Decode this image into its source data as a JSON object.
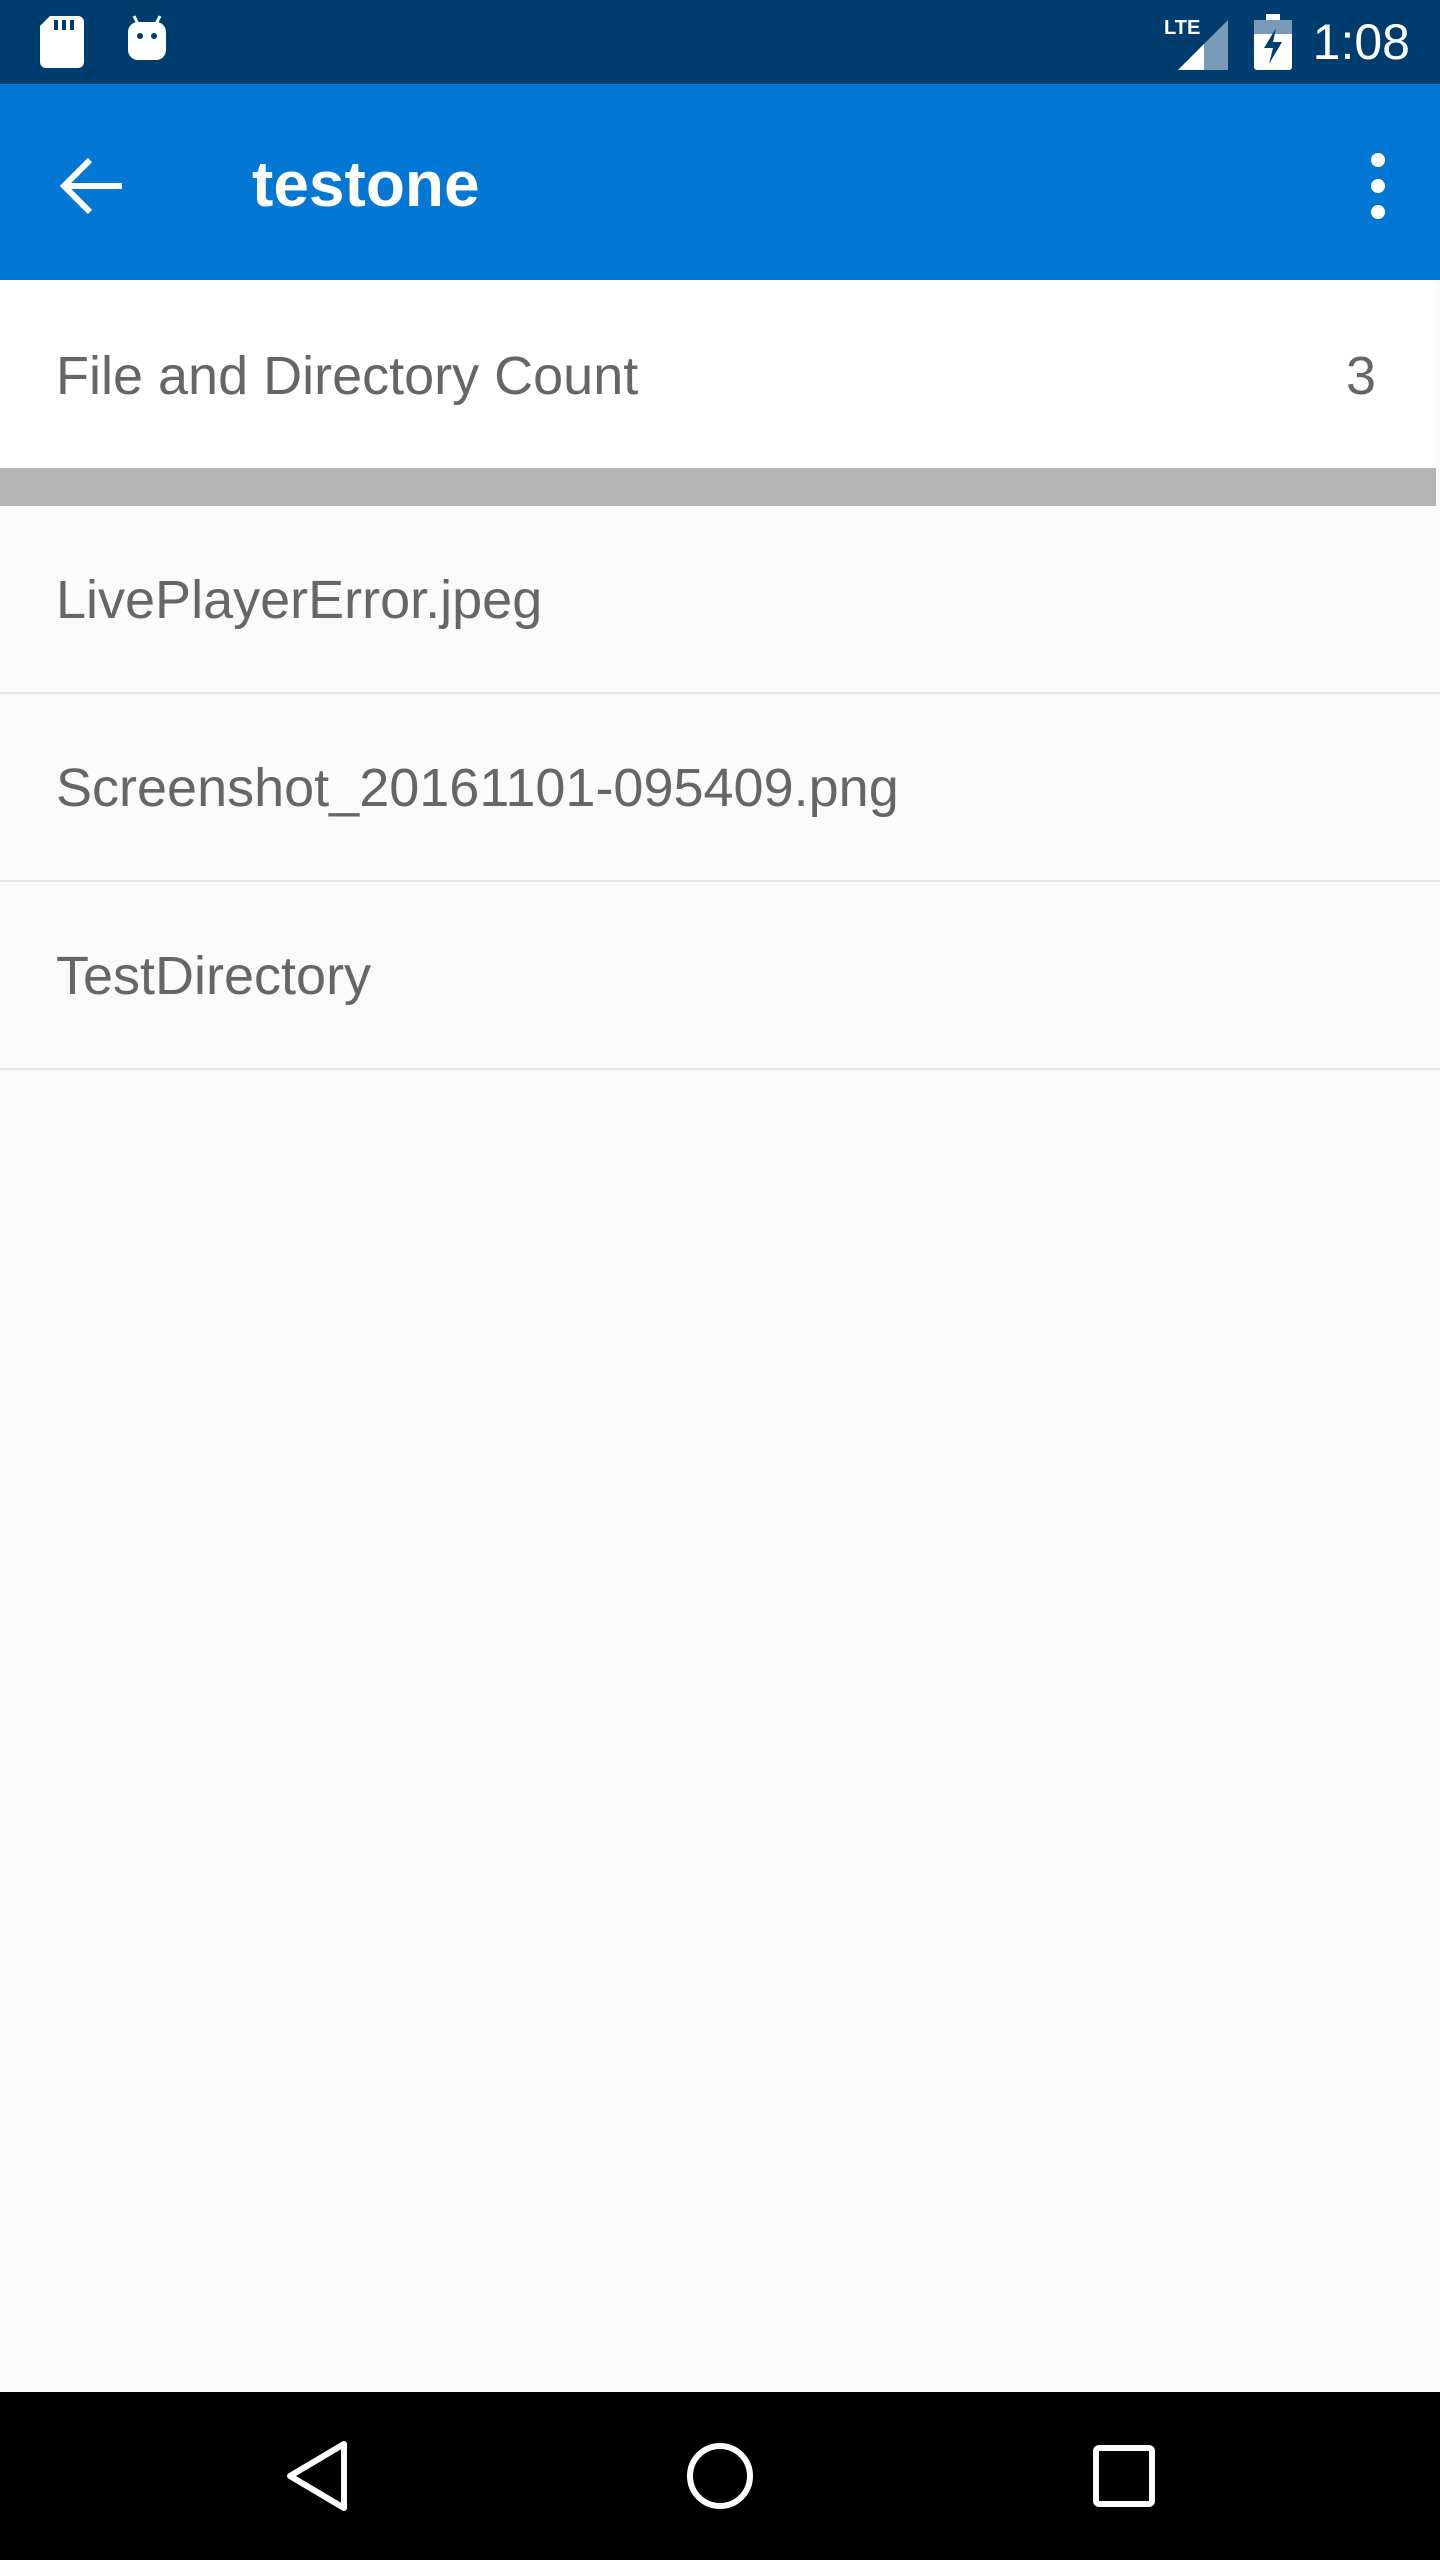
{
  "status_bar": {
    "time": "1:08",
    "network": "LTE",
    "icons": [
      "sd-card-icon",
      "android-icon",
      "lte-signal-icon",
      "battery-charging-icon"
    ]
  },
  "app_bar": {
    "title": "testone",
    "back_icon": "arrow-back-icon",
    "menu_icon": "more-vert-icon",
    "color": "#0277d4"
  },
  "summary": {
    "label": "File and Directory Count",
    "count": "3"
  },
  "files": [
    {
      "name": "LivePlayerError.jpeg"
    },
    {
      "name": "Screenshot_20161101-095409.png"
    },
    {
      "name": "TestDirectory"
    }
  ],
  "nav_bar": {
    "icons": [
      "back-triangle-icon",
      "home-circle-icon",
      "recents-square-icon"
    ]
  },
  "colors": {
    "status_bar": "#003d6f",
    "app_bar": "#0277d4",
    "text": "#666666",
    "background": "#fafafa"
  }
}
